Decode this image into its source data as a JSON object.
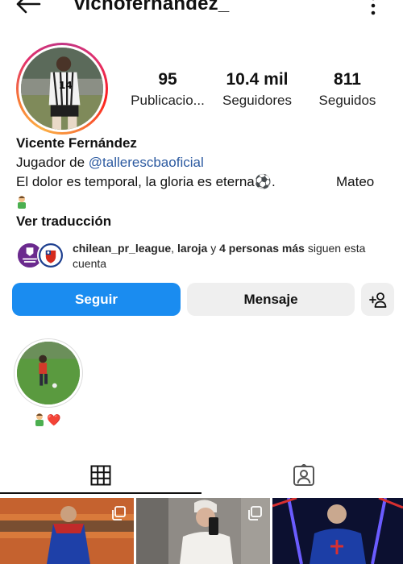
{
  "header": {
    "username": "vichofernandez_",
    "back_icon": "back-arrow-icon",
    "more_icon": "more-vertical-icon"
  },
  "stats": {
    "posts": {
      "value": "95",
      "label": "Publicacio..."
    },
    "followers": {
      "value": "10.4 mil",
      "label": "Seguidores"
    },
    "following": {
      "value": "811",
      "label": "Seguidos"
    }
  },
  "bio": {
    "name": "Vicente Fernández",
    "line2_prefix": "Jugador de ",
    "line2_link": "@tallerescbaoficial",
    "line3_text": "El dolor es temporal, la gloria es eterna",
    "line3_emoji": "⚽",
    "line3_end": ".",
    "line3_right": "Mateo",
    "translate": "Ver traducción"
  },
  "followed_by": {
    "account1": "chilean_pr_league",
    "sep1": ", ",
    "account2": "laroja",
    "sep2": " y ",
    "more": "4 personas más",
    "suffix": " siguen esta cuenta"
  },
  "actions": {
    "follow": "Seguir",
    "message": "Mensaje",
    "add_user_icon": "add-user-icon"
  },
  "highlight": {
    "label_emoji": "❤️"
  },
  "tabs": {
    "grid_icon": "grid-icon",
    "tagged_icon": "tagged-icon"
  },
  "colors": {
    "follow_button": "#1a8cf0",
    "link": "#2c5aa0",
    "secondary_button": "#efefef"
  }
}
